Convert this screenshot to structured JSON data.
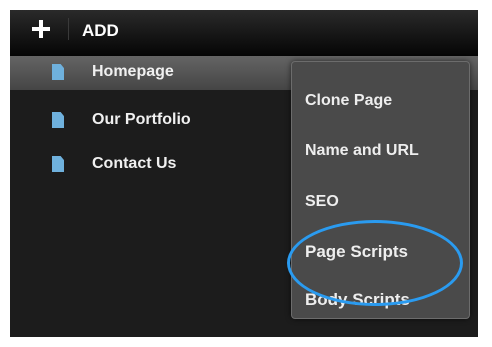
{
  "toolbar": {
    "add_icon": "plus-icon",
    "add_label": "ADD"
  },
  "pages": [
    {
      "label": "Homepage",
      "icon": "page-icon",
      "selected": true
    },
    {
      "label": "Our Portfolio",
      "icon": "page-icon",
      "selected": false
    },
    {
      "label": "Contact Us",
      "icon": "page-icon",
      "selected": false
    }
  ],
  "context_menu": {
    "items": [
      {
        "label": "Clone Page"
      },
      {
        "label": "Name and URL"
      },
      {
        "label": "SEO"
      },
      {
        "label": "Page Scripts"
      },
      {
        "label": "Body Scripts"
      }
    ]
  },
  "colors": {
    "panel_bg": "#1c1c1c",
    "selected_row": "#555555",
    "menu_bg": "#4a4a4a",
    "page_icon": "#6fb1dd",
    "annotation_ellipse": "#2a9bf0"
  }
}
